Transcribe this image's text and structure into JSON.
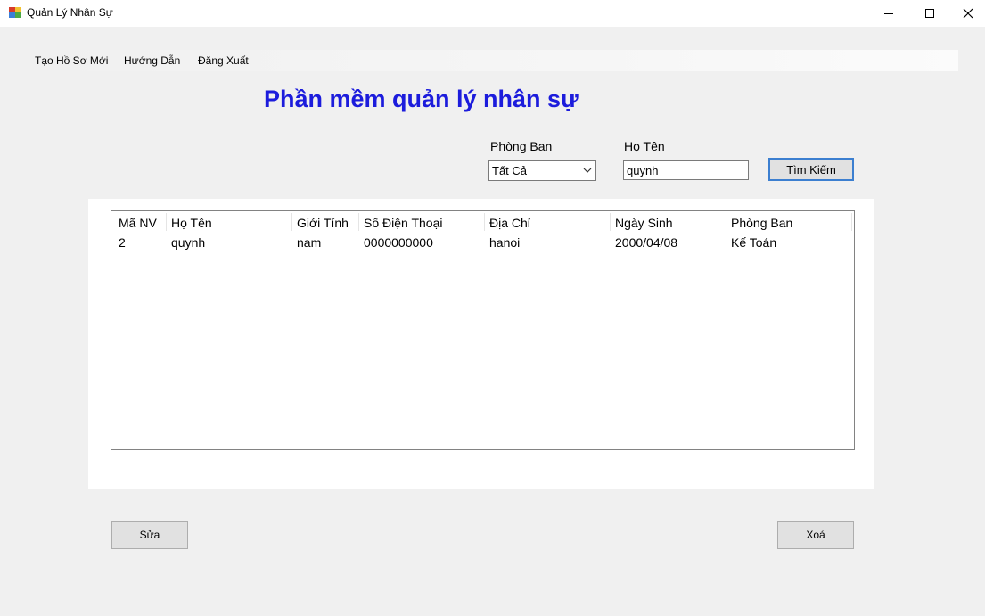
{
  "window": {
    "title": "Quản Lý Nhân Sự"
  },
  "menu": {
    "items": [
      "Tạo Hồ Sơ Mới",
      "Hướng Dẫn",
      "Đăng Xuất"
    ]
  },
  "heading": "Phần mềm quản lý nhân sự",
  "filters": {
    "department_label": "Phòng Ban",
    "department_value": "Tất Cả",
    "name_label": "Họ Tên",
    "name_value": "quynh",
    "search_button": "Tìm Kiếm"
  },
  "table": {
    "columns": [
      "Mã NV",
      "Họ Tên",
      "Giới Tính",
      "Số Điện Thoại",
      "Địa Chỉ",
      "Ngày Sinh",
      "Phòng Ban"
    ],
    "rows": [
      [
        "2",
        "quynh",
        "nam",
        "0000000000",
        "hanoi",
        "2000/04/08",
        "Kế Toán"
      ]
    ]
  },
  "actions": {
    "edit_button": "Sửa",
    "delete_button": "Xoá"
  }
}
